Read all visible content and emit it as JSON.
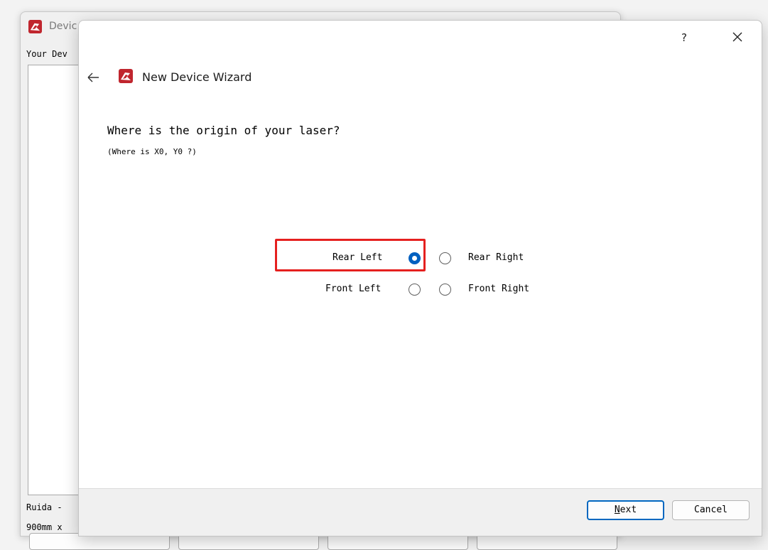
{
  "background_window": {
    "title": "Devic",
    "devices_label": "Your Dev",
    "device_name": "Ruida -",
    "device_size": "900mm x"
  },
  "wizard": {
    "help_label": "?",
    "title": "New Device Wizard",
    "question": "Where is the origin of your laser?",
    "subquestion": "(Where is X0, Y0 ?)",
    "origin_options": {
      "rear_left": "Rear Left",
      "rear_right": "Rear Right",
      "front_left": "Front Left",
      "front_right": "Front Right"
    },
    "selected_origin": "Rear Left",
    "buttons": {
      "next_mnemonic": "N",
      "next_rest": "ext",
      "cancel": "Cancel"
    }
  },
  "colors": {
    "accent": "#0060c0",
    "highlight": "#e5201f",
    "app_icon": "#c0262e"
  },
  "icons": {
    "back": "arrow-left-icon",
    "close": "close-icon",
    "app": "lightburn-logo-icon"
  }
}
